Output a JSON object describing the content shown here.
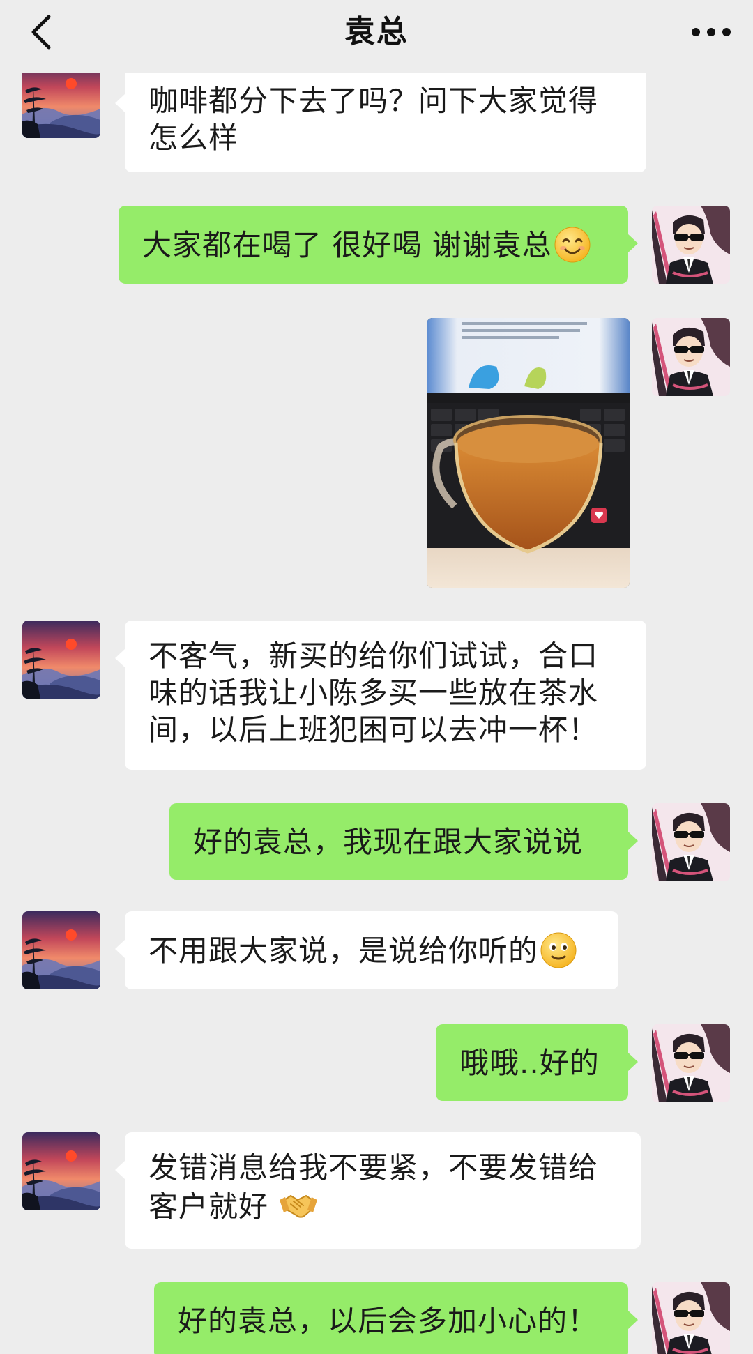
{
  "header": {
    "title": "袁总"
  },
  "messages": [
    {
      "side": "in",
      "text": "咖啡都分下去了吗？问下大家觉得怎么样"
    },
    {
      "side": "out",
      "text": "大家都在喝了 很好喝 谢谢袁总",
      "emoji": "smile-emoji"
    },
    {
      "side": "out",
      "type": "image"
    },
    {
      "side": "in",
      "text": "不客气，新买的给你们试试，合口味的话我让小陈多买一些放在茶水间，以后上班犯困可以去冲一杯！"
    },
    {
      "side": "out",
      "text": "好的袁总，我现在跟大家说说"
    },
    {
      "side": "in",
      "text": "不用跟大家说，是说给你听的",
      "emoji": "slight-smile-emoji"
    },
    {
      "side": "out",
      "text": "哦哦..好的"
    },
    {
      "side": "in",
      "text": "发错消息给我不要紧，不要发错给客户就好",
      "emoji": "handshake-emoji"
    },
    {
      "side": "out",
      "text": "好的袁总，以后会多加小心的！"
    }
  ],
  "icons": {
    "back": "chevron-left-icon",
    "more": "more-dots-icon"
  },
  "colors": {
    "background": "#ededed",
    "incoming_bubble": "#ffffff",
    "outgoing_bubble": "#95ec69"
  }
}
